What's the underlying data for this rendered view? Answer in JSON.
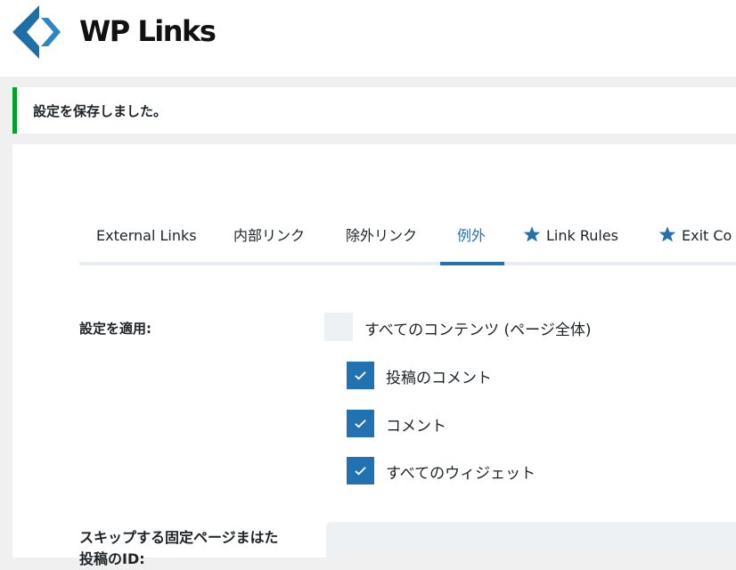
{
  "brand": {
    "name": "WP Links",
    "accent": "#2271b1",
    "logo_color": "#2271b1"
  },
  "notice": {
    "text": "設定を保存しました。",
    "border_color": "#00a32a"
  },
  "tabs": [
    {
      "label": "External Links",
      "icon": ""
    },
    {
      "label": "内部リンク",
      "icon": ""
    },
    {
      "label": "除外リンク",
      "icon": ""
    },
    {
      "label": "例外",
      "icon": "",
      "active": true
    },
    {
      "label": "Link Rules",
      "icon": "star-icon"
    },
    {
      "label": "Exit Co",
      "icon": "star-icon"
    }
  ],
  "apply_settings": {
    "label": "設定を適用:",
    "all_content": {
      "label": "すべてのコンテンツ (ページ全体)",
      "checked": false
    },
    "options": [
      {
        "label": "投稿のコメント",
        "checked": true
      },
      {
        "label": "コメント",
        "checked": true
      },
      {
        "label": "すべてのウィジェット",
        "checked": true
      }
    ]
  },
  "skip_pages": {
    "label_line1": "スキップする固定ページまはた",
    "label_line2": "投稿のID:",
    "value": ""
  }
}
